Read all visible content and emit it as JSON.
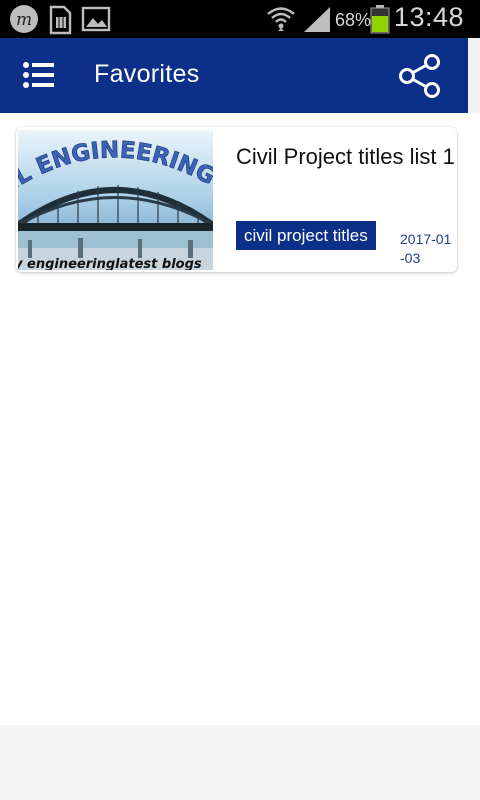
{
  "status_bar": {
    "battery_percent": "68%",
    "time": "13:48",
    "icons": [
      "m-app-icon",
      "sim-card-icon",
      "image-icon",
      "wifi-icon",
      "signal-icon",
      "battery-icon"
    ],
    "battery_color": "#8fd400"
  },
  "app_bar": {
    "title": "Favorites",
    "menu_icon": "list-menu-icon",
    "share_icon": "share-icon",
    "background": "#0c2f8a"
  },
  "favorites": [
    {
      "title": "Civil Project titles list 1",
      "thumbnail_text_top": "IL ENGINEERING",
      "thumbnail_text_bottom": "y engineeringlatest blogs",
      "tag": "civil project titles",
      "date": "2017-01-03"
    }
  ]
}
